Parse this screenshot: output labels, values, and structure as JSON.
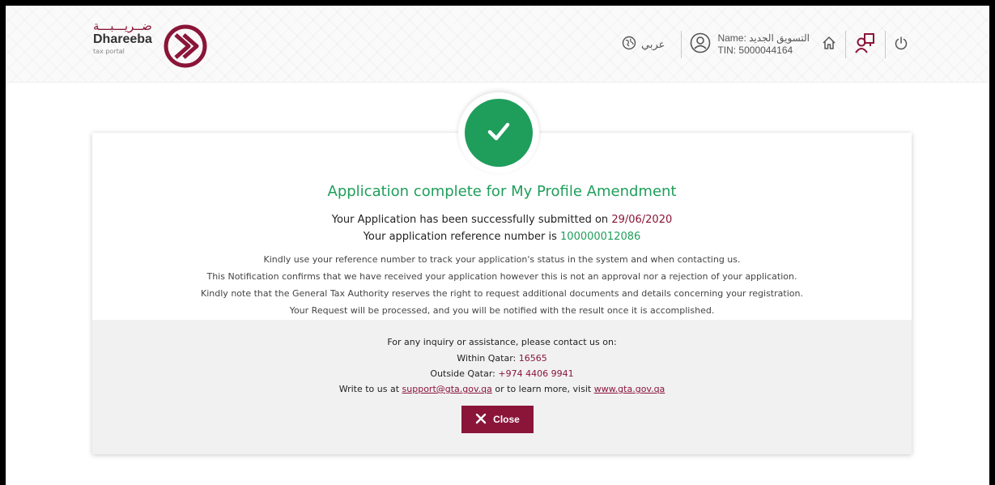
{
  "header": {
    "logo": {
      "arabic": "ضــريـــبـــة",
      "name": "Dhareeba",
      "sub": "tax portal"
    },
    "language_label": "عربي",
    "user": {
      "name_line": "Name: التسويق الجديد",
      "tin_line": "TIN: 5000044164"
    },
    "icons": [
      "globe-icon",
      "user-circle-icon",
      "home-icon",
      "profile-switch-icon",
      "power-icon"
    ]
  },
  "confirmation": {
    "title": "Application complete for My Profile Amendment",
    "submitted_prefix": "Your Application has been successfully submitted on",
    "submitted_date": "29/06/2020",
    "reference_prefix": "Your application reference number is",
    "reference_number": "100000012086",
    "notes": [
      "Kindly use your reference number to track your application's status in the system and when contacting us.",
      "This Notification confirms that we have received your application however this is not an approval nor a rejection of your application.",
      "Kindly note that the General Tax Authority reserves the right to request additional documents and details concerning your registration.",
      "Your Request will be processed, and you will be notified with the result once it is accomplished."
    ]
  },
  "contact": {
    "intro": "For any inquiry or assistance, please contact us on:",
    "within_label": "Within Qatar:",
    "within_value": "16565",
    "outside_label": "Outside Qatar:",
    "outside_value": "+974 4406 9941",
    "write_prefix": "Write to us at",
    "email": "support@gta.gov.qa",
    "write_middle": "or to learn more, visit",
    "website": "www.gta.gov.qa"
  },
  "close_label": "Close",
  "colors": {
    "brand": "#8a1538",
    "success": "#1f9e5b"
  }
}
